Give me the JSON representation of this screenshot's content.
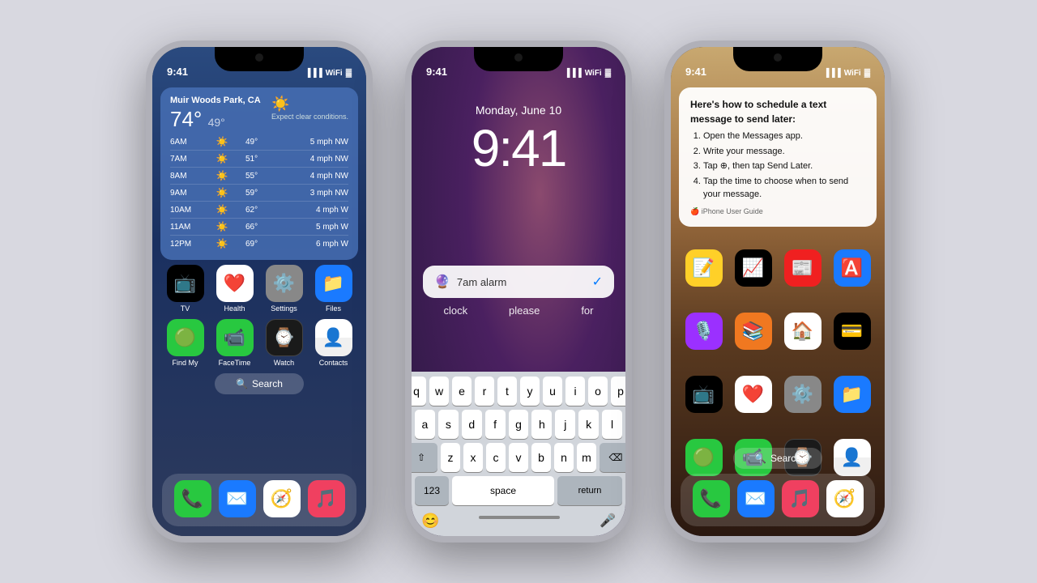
{
  "bg_color": "#d8d8e0",
  "phone1": {
    "status_time": "9:41",
    "location": "Muir Woods Park, CA",
    "condition": "Expect clear conditions.",
    "temp_high": "74°",
    "temp_low": "49°",
    "weather_rows": [
      {
        "time": "6AM",
        "icon": "☀️",
        "temp": "49°",
        "wind": "5 mph NW"
      },
      {
        "time": "7AM",
        "icon": "☀️",
        "temp": "51°",
        "wind": "4 mph NW"
      },
      {
        "time": "8AM",
        "icon": "☀️",
        "temp": "55°",
        "wind": "4 mph NW"
      },
      {
        "time": "9AM",
        "icon": "☀️",
        "temp": "59°",
        "wind": "3 mph NW"
      },
      {
        "time": "10AM",
        "icon": "☀️",
        "temp": "62°",
        "wind": "4 mph W"
      },
      {
        "time": "11AM",
        "icon": "☀️",
        "temp": "66°",
        "wind": "5 mph W"
      },
      {
        "time": "12PM",
        "icon": "☀️",
        "temp": "69°",
        "wind": "6 mph W"
      }
    ],
    "dock_row1": [
      {
        "label": "TV",
        "class": "ic-tv"
      },
      {
        "label": "Health",
        "class": "ic-health"
      },
      {
        "label": "Settings",
        "class": "ic-settings"
      },
      {
        "label": "Files",
        "class": "ic-files"
      }
    ],
    "dock_row2": [
      {
        "label": "Find My",
        "class": "ic-findmy"
      },
      {
        "label": "FaceTime",
        "class": "ic-facetime"
      },
      {
        "label": "Watch",
        "class": "ic-watch"
      },
      {
        "label": "Contacts",
        "class": "ic-contacts"
      }
    ],
    "search_label": "Search",
    "dock_apps": [
      {
        "label": "Phone",
        "class": "ic-phone"
      },
      {
        "label": "Mail",
        "class": "ic-mail"
      },
      {
        "label": "Safari",
        "class": "ic-safari"
      },
      {
        "label": "Music",
        "class": "ic-music"
      }
    ]
  },
  "phone2": {
    "status_time": "9:41",
    "date": "Monday, June 10",
    "time": "9:41",
    "siri_text": "7am alarm",
    "autocomplete": [
      "clock",
      "please",
      "for"
    ],
    "kb_row1": [
      "q",
      "w",
      "e",
      "r",
      "t",
      "y",
      "u",
      "i",
      "o",
      "p"
    ],
    "kb_row2": [
      "a",
      "s",
      "d",
      "f",
      "g",
      "h",
      "j",
      "k",
      "l"
    ],
    "kb_row3": [
      "z",
      "x",
      "c",
      "v",
      "b",
      "n",
      "m"
    ],
    "kb_numbers": "123",
    "kb_space": "space",
    "kb_return": "return"
  },
  "phone3": {
    "status_time": "9:41",
    "info_card": {
      "title": "Here's how to schedule a text message to send later:",
      "steps": [
        "Open the Messages app.",
        "Write your message.",
        "Tap ⊕, then tap Send Later.",
        "Tap the time to choose when to send your message."
      ],
      "footer": "iPhone User Guide"
    },
    "row_labels_1": [
      "Notes",
      "Stocks",
      "News",
      "App Store"
    ],
    "row_apps_1": [
      {
        "label": "Notes",
        "class": "ic-notes"
      },
      {
        "label": "Stocks",
        "class": "ic-stocks"
      },
      {
        "label": "News",
        "class": "ic-news"
      },
      {
        "label": "App Store",
        "class": "ic-appstore"
      }
    ],
    "row_labels_2": [
      "Podcasts",
      "Books",
      "Home",
      "Wallet"
    ],
    "row_apps_2": [
      {
        "label": "Podcasts",
        "class": "ic-podcasts"
      },
      {
        "label": "Books",
        "class": "ic-books"
      },
      {
        "label": "Home",
        "class": "ic-home"
      },
      {
        "label": "Wallet",
        "class": "ic-wallet"
      }
    ],
    "row_labels_3": [
      "TV",
      "Health",
      "Settings",
      "Files"
    ],
    "row_apps_3": [
      {
        "label": "TV",
        "class": "ic-tv"
      },
      {
        "label": "Health",
        "class": "ic-health"
      },
      {
        "label": "Settings",
        "class": "ic-settings"
      },
      {
        "label": "Files",
        "class": "ic-files"
      }
    ],
    "row_labels_4": [
      "Find My",
      "FaceTime",
      "Watch",
      "Contacts"
    ],
    "row_apps_4": [
      {
        "label": "Find My",
        "class": "ic-findmy"
      },
      {
        "label": "FaceTime",
        "class": "ic-facetime"
      },
      {
        "label": "Watch",
        "class": "ic-watch"
      },
      {
        "label": "Contacts",
        "class": "ic-contacts"
      }
    ],
    "search_label": "Search",
    "dock_apps": [
      {
        "label": "Phone",
        "class": "ic-phone"
      },
      {
        "label": "Mail",
        "class": "ic-mail"
      },
      {
        "label": "Music",
        "class": "ic-music"
      },
      {
        "label": "Safari",
        "class": "ic-safari"
      }
    ]
  }
}
